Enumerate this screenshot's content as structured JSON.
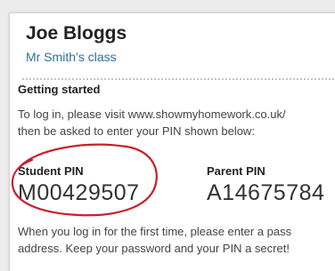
{
  "card": {
    "student_name": "Joe Bloggs",
    "class_name": "Mr Smith’s class"
  },
  "getting_started": {
    "heading": "Getting started",
    "instructions_line1": "To log in, please visit www.showmyhomework.co.uk/",
    "instructions_line2": "then be asked to enter your PIN shown below:"
  },
  "pins": {
    "student_label": "Student PIN",
    "student_pin": "M00429507",
    "parent_label": "Parent PIN",
    "parent_pin": "A14675784"
  },
  "footer": {
    "line1": "When you log in for the first time, please enter a pass",
    "line2": "address. Keep your password and your PIN a secret!"
  },
  "colors": {
    "class_link": "#2f6fa0",
    "highlight_circle": "#c8202c",
    "card_background": "#ffffff",
    "page_background": "#ececec"
  }
}
